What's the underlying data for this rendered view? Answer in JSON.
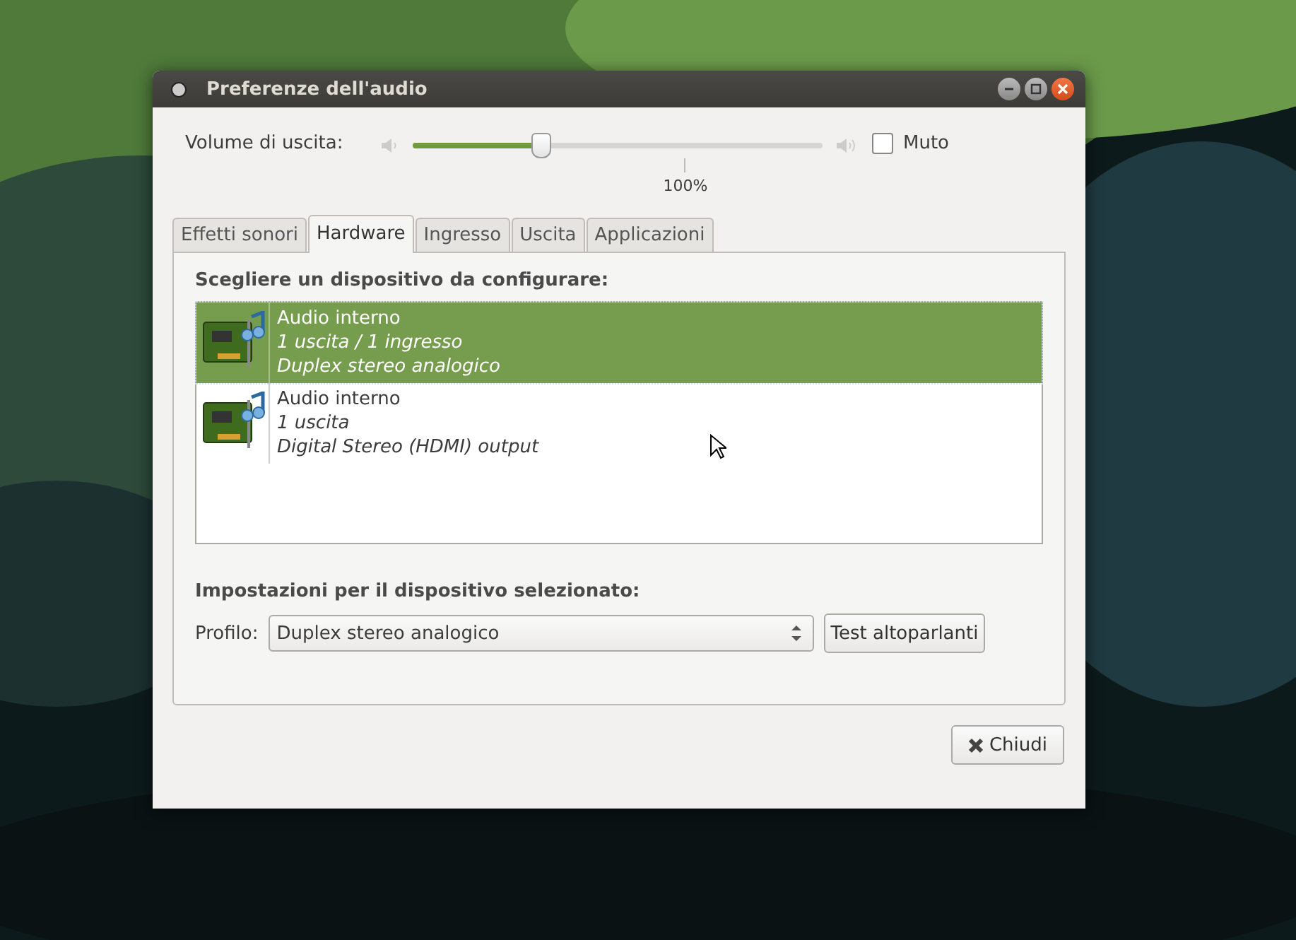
{
  "window": {
    "title": "Preferenze dell'audio"
  },
  "volume": {
    "label": "Volume di uscita:",
    "level": 0.31,
    "mark_label": "100%",
    "mute": {
      "label": "Muto",
      "checked": false
    }
  },
  "tabs": [
    {
      "label": "Effetti sonori",
      "selected": false
    },
    {
      "label": "Hardware",
      "selected": true
    },
    {
      "label": "Ingresso",
      "selected": false
    },
    {
      "label": "Uscita",
      "selected": false
    },
    {
      "label": "Applicazioni",
      "selected": false
    }
  ],
  "devices": {
    "heading": "Scegliere un dispositivo da configurare:",
    "items": [
      {
        "name": "Audio interno",
        "ports": "1 uscita / 1 ingresso",
        "profile": "Duplex stereo analogico",
        "selected": true
      },
      {
        "name": "Audio interno",
        "ports": "1 uscita",
        "profile": "Digital Stereo (HDMI) output",
        "selected": false
      }
    ]
  },
  "settings": {
    "heading": "Impostazioni per il dispositivo selezionato:",
    "profile_label": "Profilo:",
    "profile_value": "Duplex stereo analogico",
    "test_button": "Test altoparlanti"
  },
  "close_button": "Chiudi"
}
